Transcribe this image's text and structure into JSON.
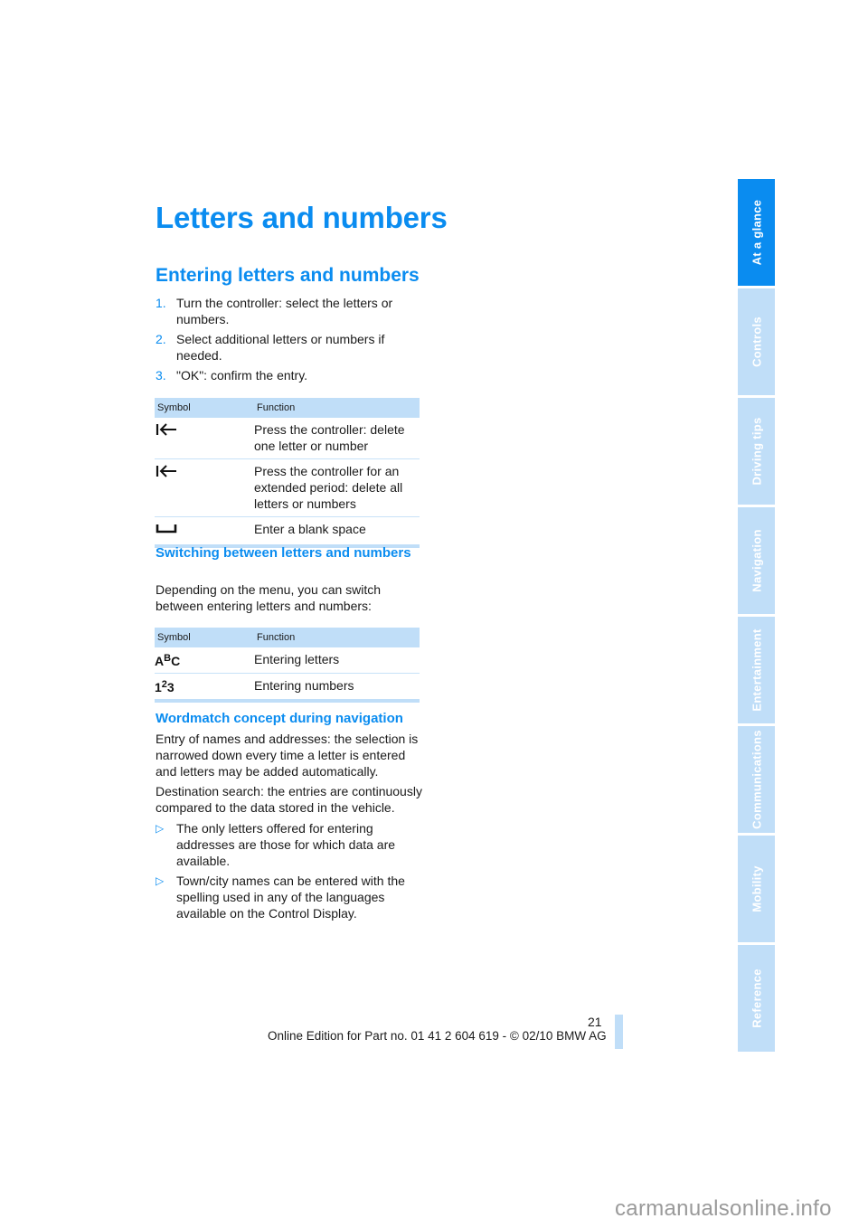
{
  "page": {
    "title": "Letters and numbers",
    "page_number": "21",
    "footer": "Online Edition for Part no. 01 41 2 604 619 - © 02/10 BMW AG",
    "watermark": "carmanualsonline.info"
  },
  "section_entering": {
    "heading": "Entering letters and numbers",
    "steps": [
      {
        "num": "1.",
        "text": "Turn the controller: select the letters or numbers."
      },
      {
        "num": "2.",
        "text": "Select additional letters or numbers if needed."
      },
      {
        "num": "3.",
        "text": "\"OK\": confirm the entry."
      }
    ],
    "table": {
      "headers": [
        "Symbol",
        "Function"
      ],
      "rows": [
        {
          "symbol_icon": "delete-back-icon",
          "symbol": "|←",
          "function": "Press the controller: delete one letter or number"
        },
        {
          "symbol_icon": "delete-back-icon",
          "symbol": "|←",
          "function": "Press the controller for an extended period: delete all letters or numbers"
        },
        {
          "symbol_icon": "space-icon",
          "symbol": "␣",
          "function": "Enter a blank space"
        }
      ]
    }
  },
  "section_switching": {
    "heading": "Switching between letters and numbers",
    "text": "Depending on the menu, you can switch between entering letters and numbers:",
    "table": {
      "headers": [
        "Symbol",
        "Function"
      ],
      "rows": [
        {
          "symbol_icon": "letters-mode-icon",
          "symbol_parts": [
            "A",
            "B",
            "C"
          ],
          "function": "Entering letters"
        },
        {
          "symbol_icon": "numbers-mode-icon",
          "symbol_parts": [
            "1",
            "2",
            "3"
          ],
          "function": "Entering numbers"
        }
      ]
    }
  },
  "section_wordmatch": {
    "heading": "Wordmatch concept during navigation",
    "paragraphs": [
      "Entry of names and addresses: the selection is narrowed down every time a letter is entered and letters may be added automatically.",
      "Destination search: the entries are continuously compared to the data stored in the vehicle."
    ],
    "bullets": [
      "The only letters offered for entering addresses are those for which data are available.",
      "Town/city names can be entered with the spelling used in any of the languages available on the Control Display."
    ],
    "bullet_marker": "▷"
  },
  "sidebar": {
    "active_index": 0,
    "tabs": [
      {
        "label": "At a glance"
      },
      {
        "label": "Controls"
      },
      {
        "label": "Driving tips"
      },
      {
        "label": "Navigation"
      },
      {
        "label": "Entertainment"
      },
      {
        "label": "Communications"
      },
      {
        "label": "Mobility"
      },
      {
        "label": "Reference"
      }
    ]
  },
  "colors": {
    "accent": "#0a8cf0",
    "tab_inactive": "#c0def8",
    "table_header": "#c0def8"
  }
}
